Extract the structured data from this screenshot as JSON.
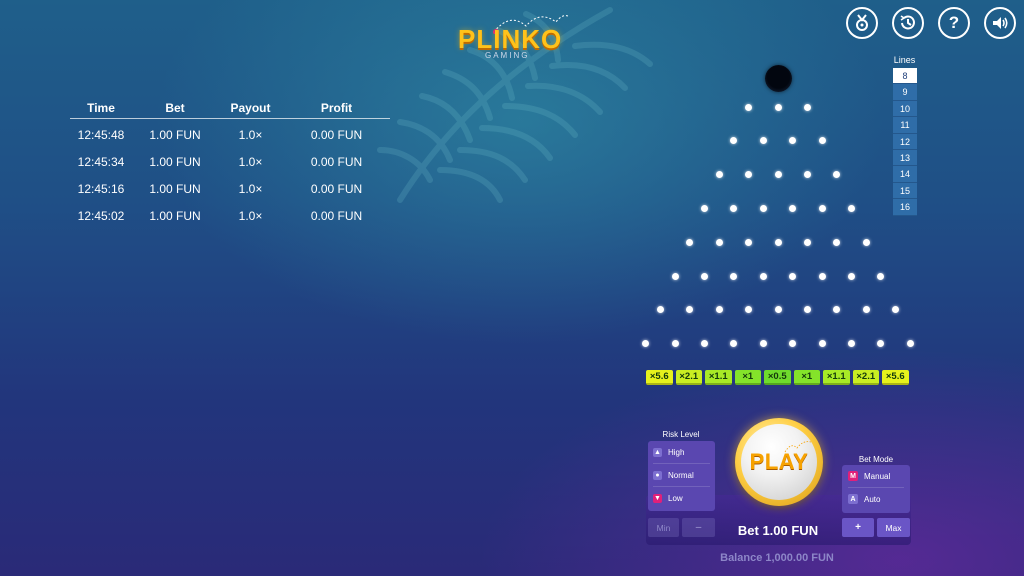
{
  "header": {
    "logo_text": "PLINKO",
    "logo_subtext": "GAMING",
    "icons": [
      "trophy-icon",
      "history-icon",
      "help-icon",
      "sound-icon"
    ]
  },
  "history": {
    "columns": [
      "Time",
      "Bet",
      "Payout",
      "Profit"
    ],
    "rows": [
      {
        "time": "12:45:48",
        "bet": "1.00 FUN",
        "payout": "1.0×",
        "profit": "0.00 FUN"
      },
      {
        "time": "12:45:34",
        "bet": "1.00 FUN",
        "payout": "1.0×",
        "profit": "0.00 FUN"
      },
      {
        "time": "12:45:16",
        "bet": "1.00 FUN",
        "payout": "1.0×",
        "profit": "0.00 FUN"
      },
      {
        "time": "12:45:02",
        "bet": "1.00 FUN",
        "payout": "1.0×",
        "profit": "0.00 FUN"
      }
    ]
  },
  "lines": {
    "label": "Lines",
    "options": [
      "8",
      "9",
      "10",
      "11",
      "12",
      "13",
      "14",
      "15",
      "16"
    ],
    "selected": "8"
  },
  "board": {
    "peg_rows": 8,
    "multipliers": [
      {
        "label": "×5.6",
        "color": "#e6f21c"
      },
      {
        "label": "×2.1",
        "color": "#c9ee22"
      },
      {
        "label": "×1.1",
        "color": "#a8ea26"
      },
      {
        "label": "×1",
        "color": "#84e32a"
      },
      {
        "label": "×0.5",
        "color": "#6fdc2c"
      },
      {
        "label": "×1",
        "color": "#84e32a"
      },
      {
        "label": "×1.1",
        "color": "#a8ea26"
      },
      {
        "label": "×2.1",
        "color": "#c9ee22"
      },
      {
        "label": "×5.6",
        "color": "#e6f21c"
      }
    ]
  },
  "controls": {
    "risk_label": "Risk Level",
    "risk_options": [
      {
        "label": "High",
        "icon": "high-risk-icon",
        "color": "#7d6fd0"
      },
      {
        "label": "Normal",
        "icon": "normal-risk-icon",
        "color": "#7d6fd0"
      },
      {
        "label": "Low",
        "icon": "low-risk-icon",
        "color": "#e0207a"
      }
    ],
    "bet_mode_label": "Bet Mode",
    "bet_modes": [
      {
        "label": "Manual",
        "letter": "M",
        "color": "#e0207a"
      },
      {
        "label": "Auto",
        "letter": "A",
        "color": "#7d6fd0"
      }
    ],
    "play_label": "PLAY",
    "min_label": "Min",
    "minus_label": "–",
    "plus_label": "+",
    "max_label": "Max",
    "bet_text": "Bet 1.00 FUN",
    "balance_text": "Balance 1,000.00 FUN"
  }
}
